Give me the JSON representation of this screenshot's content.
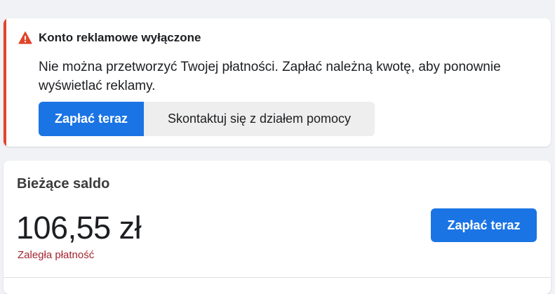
{
  "alert": {
    "icon": "warning-icon",
    "accent_color": "#e0452b",
    "title": "Konto reklamowe wyłączone",
    "message": "Nie można przetworzyć Twojej płatności. Zapłać należną kwotę, aby ponownie wyświetlać reklamy.",
    "pay_button": "Zapłać teraz",
    "help_button": "Skontaktuj się z działem pomocy"
  },
  "balance": {
    "title": "Bieżące saldo",
    "amount": "106,55 zł",
    "status": "Zaległa płatność",
    "status_color": "#a2252e",
    "pay_button": "Zapłać teraz"
  },
  "colors": {
    "primary": "#1b74e4",
    "background": "#f0f2f5"
  }
}
